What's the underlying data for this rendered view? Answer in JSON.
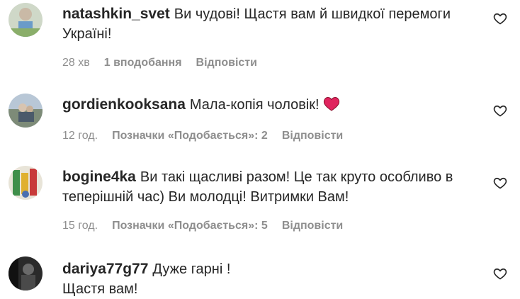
{
  "comments": [
    {
      "username": "natashkin_svet",
      "text": "Ви чудові! Щастя вам й швидкої перемоги Україні!",
      "time": "28 хв",
      "likes": "1 вподобання",
      "reply": "Відповісти",
      "avatar_icon": "user-avatar"
    },
    {
      "username": "gordienkooksana",
      "text": "Мала-копія чоловік!",
      "emoji": "red-heart-emoji",
      "time": "12 год.",
      "likes": "Позначки «Подобається»: 2",
      "reply": "Відповісти",
      "avatar_icon": "user-avatar"
    },
    {
      "username": "bogine4ka",
      "text": "Ви такі щасливі разом! Це так круто особливо в теперішній час) Ви молодці! Витримки Вам!",
      "time": "15 год.",
      "likes": "Позначки «Подобається»: 5",
      "reply": "Відповісти",
      "avatar_icon": "user-avatar"
    },
    {
      "username": "dariya77g77",
      "text": "Дуже гарні ! Щастя вам!",
      "avatar_icon": "user-avatar"
    }
  ],
  "icons": {
    "like": "heart-outline-icon"
  },
  "colors": {
    "text": "#262626",
    "secondary": "#8e8e8e",
    "heart_emoji": "#e0245e"
  }
}
